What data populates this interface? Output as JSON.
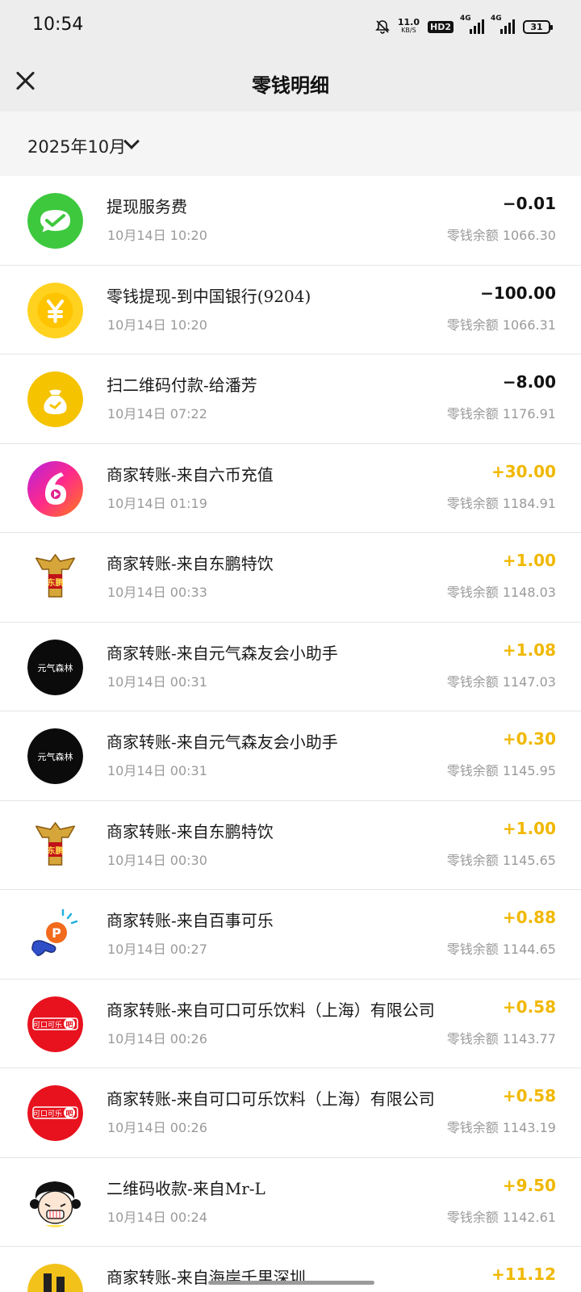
{
  "status_bar": {
    "time": "10:54",
    "speed_value": "11.0",
    "speed_unit": "KB/S",
    "hd_label": "HD2",
    "sig1_label": "4G",
    "sig2_label": "4G",
    "battery": "31"
  },
  "nav": {
    "title": "零钱明细"
  },
  "filter": {
    "month": "2025年10月"
  },
  "colors": {
    "positive": "#f1b800",
    "negative": "#111111"
  },
  "transactions": [
    {
      "icon": "wechat-pay-icon",
      "title": "提现服务费",
      "time": "10月14日  10:20",
      "amount": "−0.01",
      "balance": "零钱余额 1066.30"
    },
    {
      "icon": "yuan-coin-icon",
      "title": "零钱提现-到中国银行(9204)",
      "time": "10月14日  10:20",
      "amount": "−100.00",
      "balance": "零钱余额 1066.31"
    },
    {
      "icon": "money-bag-icon",
      "title": "扫二维码付款-给潘芳",
      "time": "10月14日  07:22",
      "amount": "−8.00",
      "balance": "零钱余额 1176.91"
    },
    {
      "icon": "liubi-logo-icon",
      "title": "商家转账-来自六币充值",
      "time": "10月14日  01:19",
      "amount": "+30.00",
      "balance": "零钱余额 1184.91"
    },
    {
      "icon": "dongpeng-logo-icon",
      "title": "商家转账-来自东鹏特饮",
      "time": "10月14日  00:33",
      "amount": "+1.00",
      "balance": "零钱余额 1148.03"
    },
    {
      "icon": "genki-forest-logo-icon",
      "title": "商家转账-来自元气森友会小助手",
      "time": "10月14日  00:31",
      "amount": "+1.08",
      "balance": "零钱余额 1147.03"
    },
    {
      "icon": "genki-forest-logo-icon",
      "title": "商家转账-来自元气森友会小助手",
      "time": "10月14日  00:31",
      "amount": "+0.30",
      "balance": "零钱余额 1145.95"
    },
    {
      "icon": "dongpeng-logo-icon",
      "title": "商家转账-来自东鹏特饮",
      "time": "10月14日  00:30",
      "amount": "+1.00",
      "balance": "零钱余额 1145.65"
    },
    {
      "icon": "pepsi-hand-icon",
      "title": "商家转账-来自百事可乐",
      "time": "10月14日  00:27",
      "amount": "+0.88",
      "balance": "零钱余额 1144.65"
    },
    {
      "icon": "coca-cola-logo-icon",
      "title": "商家转账-来自可口可乐饮料（上海）有限公司",
      "time": "10月14日  00:26",
      "amount": "+0.58",
      "balance": "零钱余额 1143.77"
    },
    {
      "icon": "coca-cola-logo-icon",
      "title": "商家转账-来自可口可乐饮料（上海）有限公司",
      "time": "10月14日  00:26",
      "amount": "+0.58",
      "balance": "零钱余额 1143.19"
    },
    {
      "icon": "cartoon-avatar-icon",
      "title": "二维码收款-来自Mr-L",
      "time": "10月14日  00:24",
      "amount": "+9.50",
      "balance": "零钱余额 1142.61"
    },
    {
      "icon": "coastline-logo-icon",
      "title": "商家转账-来自海岸千里深圳",
      "time": "",
      "amount": "+11.12",
      "balance": ""
    }
  ],
  "logo_text": {
    "dongpeng": "东鹏",
    "genki": "元气森林",
    "coca": "可口可乐",
    "coca_suffix": "吧",
    "pepsi": "P"
  }
}
